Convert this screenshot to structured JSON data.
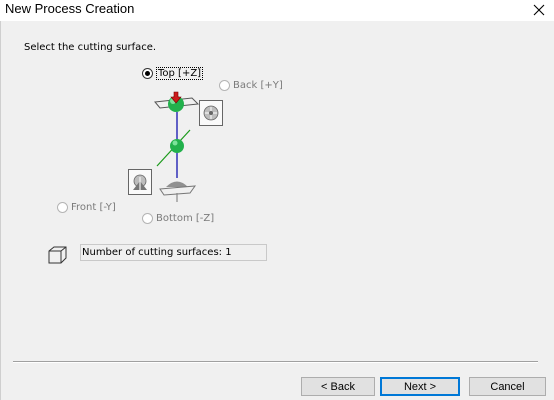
{
  "window": {
    "title": "New Process Creation"
  },
  "instruction": "Select the cutting surface.",
  "surfaces": {
    "top": {
      "label": "Top [+Z]",
      "selected": true
    },
    "back": {
      "label": "Back [+Y]",
      "selected": false
    },
    "front": {
      "label": "Front [-Y]",
      "selected": false
    },
    "bottom": {
      "label": "Bottom [-Z]",
      "selected": false
    }
  },
  "count_field": {
    "value": "Number of cutting surfaces: 1"
  },
  "buttons": {
    "back": "< Back",
    "next": "Next >",
    "cancel": "Cancel"
  },
  "icons": {
    "close": "close-icon",
    "cube": "cube-icon",
    "back_view": "back-view-icon",
    "front_view": "front-view-icon",
    "top_sphere": "top-sphere-icon",
    "center_sphere": "center-sphere-icon",
    "bottom_cap": "bottom-cap-icon"
  },
  "colors": {
    "sphere": "#22b14c",
    "arrow": "#cc1b1b",
    "axis_z": "#0000aa",
    "axis_y": "#1a9a1a",
    "default_button": "#0078d7"
  }
}
